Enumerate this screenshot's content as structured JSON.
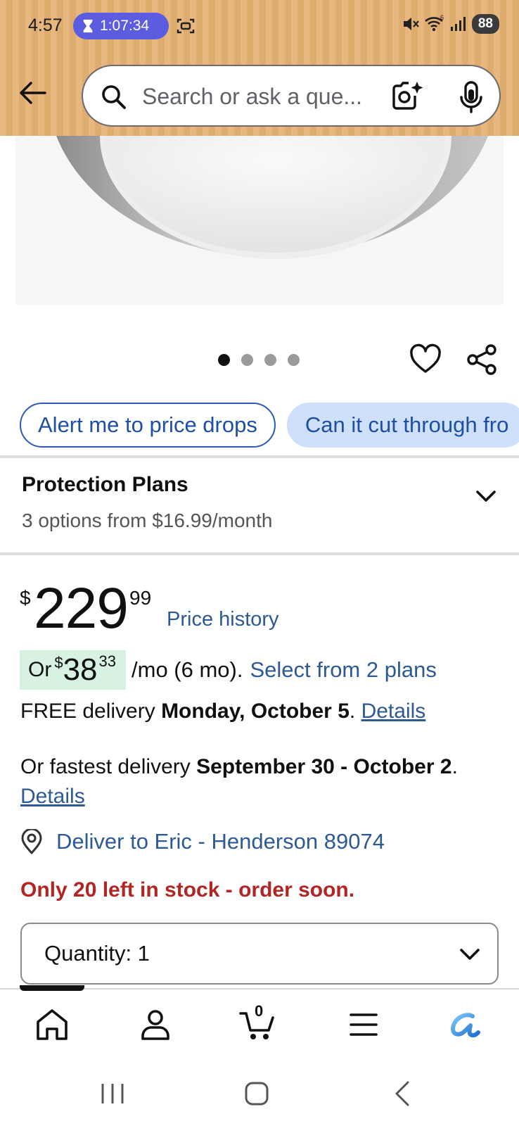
{
  "status_bar": {
    "time": "4:57",
    "timer": "1:07:34",
    "battery": "88",
    "network": "6"
  },
  "header": {
    "search_placeholder": "Search or ask a que..."
  },
  "gallery": {
    "image_count": 4,
    "active_index": 0
  },
  "chips": [
    "Alert me to price drops",
    "Can it cut through fro"
  ],
  "protection": {
    "title": "Protection Plans",
    "subtitle": "3 options from $16.99/month"
  },
  "price": {
    "currency": "$",
    "whole": "229",
    "fraction": "99",
    "history_link": "Price history"
  },
  "monthly": {
    "prefix": "Or",
    "currency": "$",
    "whole": "38",
    "fraction": "33",
    "suffix": "/mo (6 mo).",
    "link": "Select from 2 plans"
  },
  "delivery": {
    "free_prefix": "FREE delivery",
    "free_date": "Monday, October 5",
    "free_period": ".",
    "details": "Details",
    "fast_prefix": "Or fastest delivery",
    "fast_date": "September 30 - October 2",
    "fast_period": "."
  },
  "deliver_to": "Deliver to Eric - Henderson 89074",
  "stock": "Only 20 left in stock - order soon.",
  "quantity": "Quantity:  1",
  "cart": {
    "count": "0"
  },
  "colors": {
    "header": "#e8b77f",
    "link": "#2d5a94",
    "stock": "#b12525",
    "badge": "#d7f2e1",
    "chip_fill": "#cfe0fb"
  }
}
